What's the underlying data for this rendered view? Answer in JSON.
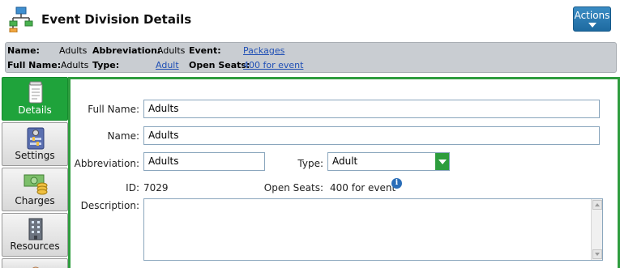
{
  "header": {
    "title": "Event Division Details",
    "icon": "hierarchy-icon",
    "actions_label": "Actions"
  },
  "summary": {
    "name_label": "Name:",
    "name_value": "Adults",
    "abbreviation_label": "Abbreviation:",
    "abbreviation_value": "Adults",
    "event_label": "Event:",
    "event_link": "Packages",
    "full_name_label": "Full Name:",
    "full_name_value": "Adults",
    "type_label": "Type:",
    "type_link": "Adult",
    "open_seats_label": "Open Seats:",
    "open_seats_link": "400 for event"
  },
  "sidenav": {
    "items": [
      {
        "label": "Details",
        "icon": "document-icon",
        "active": true
      },
      {
        "label": "Settings",
        "icon": "settings-icon",
        "active": false
      },
      {
        "label": "Charges",
        "icon": "money-icon",
        "active": false
      },
      {
        "label": "Resources",
        "icon": "building-icon",
        "active": false
      }
    ]
  },
  "form": {
    "full_name_label": "Full Name:",
    "full_name_value": "Adults",
    "name_label": "Name:",
    "name_value": "Adults",
    "abbreviation_label": "Abbreviation:",
    "abbreviation_value": "Adults",
    "type_label": "Type:",
    "type_value": "Adult",
    "id_label": "ID:",
    "id_value": "7029",
    "open_seats_label": "Open Seats:",
    "open_seats_value": "400 for event",
    "info_glyph": "i",
    "description_label": "Description:",
    "description_value": ""
  },
  "colors": {
    "accent_green": "#2f9d3f",
    "actions_blue": "#1e6aa0",
    "link_blue": "#1f4fb5",
    "summary_bg": "#c9cdd2"
  }
}
